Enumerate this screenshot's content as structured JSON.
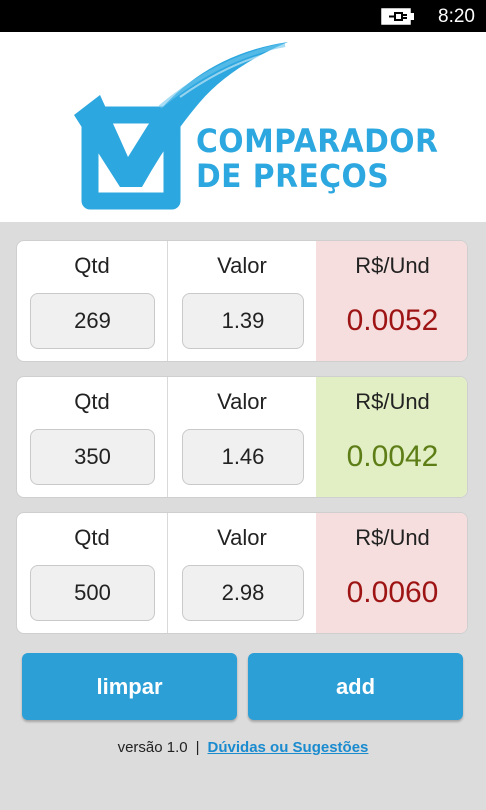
{
  "status_bar": {
    "time": "8:20",
    "battery_icon": "battery-charging-icon"
  },
  "header": {
    "logo_line1": "COMPARADOR",
    "logo_line2": "DE PREÇOS",
    "logo_icon": "checkbox-check-icon",
    "brand_color": "#2da7df"
  },
  "rows": [
    {
      "qty_label": "Qtd",
      "qty": "269",
      "value_label": "Valor",
      "value": "1.39",
      "unit_label": "R$/Und",
      "unit_price": "0.0052",
      "status": "expensive"
    },
    {
      "qty_label": "Qtd",
      "qty": "350",
      "value_label": "Valor",
      "value": "1.46",
      "unit_label": "R$/Und",
      "unit_price": "0.0042",
      "status": "cheapest"
    },
    {
      "qty_label": "Qtd",
      "qty": "500",
      "value_label": "Valor",
      "value": "2.98",
      "unit_label": "R$/Und",
      "unit_price": "0.0060",
      "status": "expensive"
    }
  ],
  "buttons": {
    "clear_label": "limpar",
    "add_label": "add"
  },
  "footer": {
    "version": "versão 1.0",
    "separator": "|",
    "link": "Dúvidas ou Sugestões"
  },
  "colors": {
    "expensive_bg": "#f6dede",
    "expensive_text": "#9e1414",
    "cheapest_bg": "#e2efc4",
    "cheapest_text": "#5d7e16",
    "button": "#2c9fd6"
  }
}
